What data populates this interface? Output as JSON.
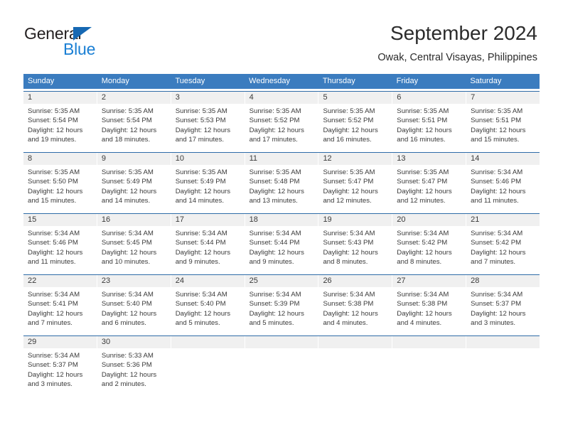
{
  "brand": {
    "name_top": "General",
    "name_bottom": "Blue",
    "triangle_color": "#1668b3",
    "blue_text_color": "#1a7fd4"
  },
  "header": {
    "title": "September 2024",
    "subtitle": "Owak, Central Visayas, Philippines"
  },
  "theme": {
    "header_bg": "#3b7cbf",
    "week_rule": "#2f6ca8",
    "daynum_bg": "#f0f0f0",
    "text": "#3a3a3a"
  },
  "weekdays": [
    "Sunday",
    "Monday",
    "Tuesday",
    "Wednesday",
    "Thursday",
    "Friday",
    "Saturday"
  ],
  "weeks": [
    [
      {
        "day": "1",
        "sunrise": "Sunrise: 5:35 AM",
        "sunset": "Sunset: 5:54 PM",
        "daylight1": "Daylight: 12 hours",
        "daylight2": "and 19 minutes."
      },
      {
        "day": "2",
        "sunrise": "Sunrise: 5:35 AM",
        "sunset": "Sunset: 5:54 PM",
        "daylight1": "Daylight: 12 hours",
        "daylight2": "and 18 minutes."
      },
      {
        "day": "3",
        "sunrise": "Sunrise: 5:35 AM",
        "sunset": "Sunset: 5:53 PM",
        "daylight1": "Daylight: 12 hours",
        "daylight2": "and 17 minutes."
      },
      {
        "day": "4",
        "sunrise": "Sunrise: 5:35 AM",
        "sunset": "Sunset: 5:52 PM",
        "daylight1": "Daylight: 12 hours",
        "daylight2": "and 17 minutes."
      },
      {
        "day": "5",
        "sunrise": "Sunrise: 5:35 AM",
        "sunset": "Sunset: 5:52 PM",
        "daylight1": "Daylight: 12 hours",
        "daylight2": "and 16 minutes."
      },
      {
        "day": "6",
        "sunrise": "Sunrise: 5:35 AM",
        "sunset": "Sunset: 5:51 PM",
        "daylight1": "Daylight: 12 hours",
        "daylight2": "and 16 minutes."
      },
      {
        "day": "7",
        "sunrise": "Sunrise: 5:35 AM",
        "sunset": "Sunset: 5:51 PM",
        "daylight1": "Daylight: 12 hours",
        "daylight2": "and 15 minutes."
      }
    ],
    [
      {
        "day": "8",
        "sunrise": "Sunrise: 5:35 AM",
        "sunset": "Sunset: 5:50 PM",
        "daylight1": "Daylight: 12 hours",
        "daylight2": "and 15 minutes."
      },
      {
        "day": "9",
        "sunrise": "Sunrise: 5:35 AM",
        "sunset": "Sunset: 5:49 PM",
        "daylight1": "Daylight: 12 hours",
        "daylight2": "and 14 minutes."
      },
      {
        "day": "10",
        "sunrise": "Sunrise: 5:35 AM",
        "sunset": "Sunset: 5:49 PM",
        "daylight1": "Daylight: 12 hours",
        "daylight2": "and 14 minutes."
      },
      {
        "day": "11",
        "sunrise": "Sunrise: 5:35 AM",
        "sunset": "Sunset: 5:48 PM",
        "daylight1": "Daylight: 12 hours",
        "daylight2": "and 13 minutes."
      },
      {
        "day": "12",
        "sunrise": "Sunrise: 5:35 AM",
        "sunset": "Sunset: 5:47 PM",
        "daylight1": "Daylight: 12 hours",
        "daylight2": "and 12 minutes."
      },
      {
        "day": "13",
        "sunrise": "Sunrise: 5:35 AM",
        "sunset": "Sunset: 5:47 PM",
        "daylight1": "Daylight: 12 hours",
        "daylight2": "and 12 minutes."
      },
      {
        "day": "14",
        "sunrise": "Sunrise: 5:34 AM",
        "sunset": "Sunset: 5:46 PM",
        "daylight1": "Daylight: 12 hours",
        "daylight2": "and 11 minutes."
      }
    ],
    [
      {
        "day": "15",
        "sunrise": "Sunrise: 5:34 AM",
        "sunset": "Sunset: 5:46 PM",
        "daylight1": "Daylight: 12 hours",
        "daylight2": "and 11 minutes."
      },
      {
        "day": "16",
        "sunrise": "Sunrise: 5:34 AM",
        "sunset": "Sunset: 5:45 PM",
        "daylight1": "Daylight: 12 hours",
        "daylight2": "and 10 minutes."
      },
      {
        "day": "17",
        "sunrise": "Sunrise: 5:34 AM",
        "sunset": "Sunset: 5:44 PM",
        "daylight1": "Daylight: 12 hours",
        "daylight2": "and 9 minutes."
      },
      {
        "day": "18",
        "sunrise": "Sunrise: 5:34 AM",
        "sunset": "Sunset: 5:44 PM",
        "daylight1": "Daylight: 12 hours",
        "daylight2": "and 9 minutes."
      },
      {
        "day": "19",
        "sunrise": "Sunrise: 5:34 AM",
        "sunset": "Sunset: 5:43 PM",
        "daylight1": "Daylight: 12 hours",
        "daylight2": "and 8 minutes."
      },
      {
        "day": "20",
        "sunrise": "Sunrise: 5:34 AM",
        "sunset": "Sunset: 5:42 PM",
        "daylight1": "Daylight: 12 hours",
        "daylight2": "and 8 minutes."
      },
      {
        "day": "21",
        "sunrise": "Sunrise: 5:34 AM",
        "sunset": "Sunset: 5:42 PM",
        "daylight1": "Daylight: 12 hours",
        "daylight2": "and 7 minutes."
      }
    ],
    [
      {
        "day": "22",
        "sunrise": "Sunrise: 5:34 AM",
        "sunset": "Sunset: 5:41 PM",
        "daylight1": "Daylight: 12 hours",
        "daylight2": "and 7 minutes."
      },
      {
        "day": "23",
        "sunrise": "Sunrise: 5:34 AM",
        "sunset": "Sunset: 5:40 PM",
        "daylight1": "Daylight: 12 hours",
        "daylight2": "and 6 minutes."
      },
      {
        "day": "24",
        "sunrise": "Sunrise: 5:34 AM",
        "sunset": "Sunset: 5:40 PM",
        "daylight1": "Daylight: 12 hours",
        "daylight2": "and 5 minutes."
      },
      {
        "day": "25",
        "sunrise": "Sunrise: 5:34 AM",
        "sunset": "Sunset: 5:39 PM",
        "daylight1": "Daylight: 12 hours",
        "daylight2": "and 5 minutes."
      },
      {
        "day": "26",
        "sunrise": "Sunrise: 5:34 AM",
        "sunset": "Sunset: 5:38 PM",
        "daylight1": "Daylight: 12 hours",
        "daylight2": "and 4 minutes."
      },
      {
        "day": "27",
        "sunrise": "Sunrise: 5:34 AM",
        "sunset": "Sunset: 5:38 PM",
        "daylight1": "Daylight: 12 hours",
        "daylight2": "and 4 minutes."
      },
      {
        "day": "28",
        "sunrise": "Sunrise: 5:34 AM",
        "sunset": "Sunset: 5:37 PM",
        "daylight1": "Daylight: 12 hours",
        "daylight2": "and 3 minutes."
      }
    ],
    [
      {
        "day": "29",
        "sunrise": "Sunrise: 5:34 AM",
        "sunset": "Sunset: 5:37 PM",
        "daylight1": "Daylight: 12 hours",
        "daylight2": "and 3 minutes."
      },
      {
        "day": "30",
        "sunrise": "Sunrise: 5:33 AM",
        "sunset": "Sunset: 5:36 PM",
        "daylight1": "Daylight: 12 hours",
        "daylight2": "and 2 minutes."
      },
      {
        "day": "",
        "sunrise": "",
        "sunset": "",
        "daylight1": "",
        "daylight2": ""
      },
      {
        "day": "",
        "sunrise": "",
        "sunset": "",
        "daylight1": "",
        "daylight2": ""
      },
      {
        "day": "",
        "sunrise": "",
        "sunset": "",
        "daylight1": "",
        "daylight2": ""
      },
      {
        "day": "",
        "sunrise": "",
        "sunset": "",
        "daylight1": "",
        "daylight2": ""
      },
      {
        "day": "",
        "sunrise": "",
        "sunset": "",
        "daylight1": "",
        "daylight2": ""
      }
    ]
  ]
}
